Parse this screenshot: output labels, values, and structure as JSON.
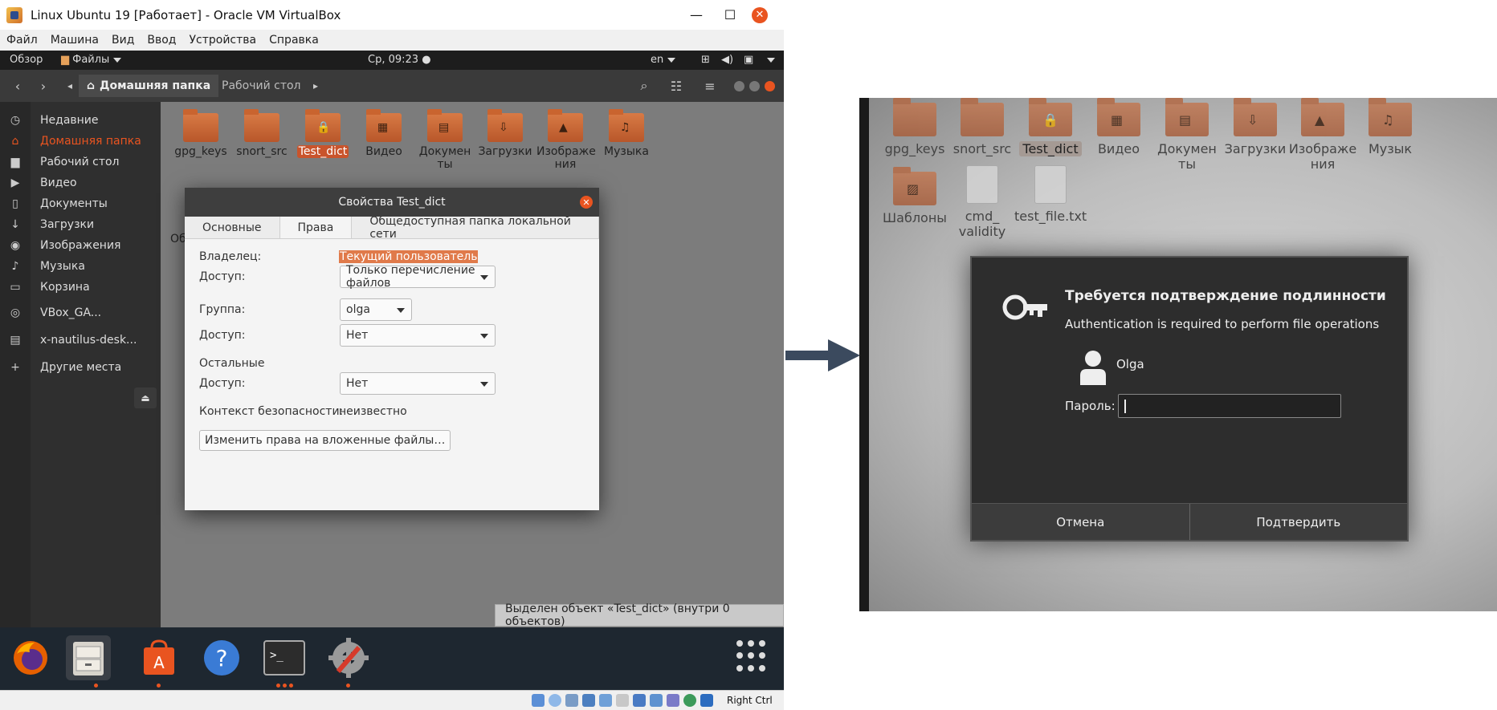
{
  "vbox": {
    "title": "Linux Ubuntu 19 [Работает] - Oracle VM VirtualBox",
    "menu": [
      "Файл",
      "Машина",
      "Вид",
      "Ввод",
      "Устройства",
      "Справка"
    ],
    "host_key": "Right Ctrl"
  },
  "gnome_topbar": {
    "overview": "Обзор",
    "app_menu": "Файлы",
    "clock": "Ср, 09:23 ●",
    "lang": "en"
  },
  "nautilus": {
    "breadcrumb_home": "Домашняя папка",
    "breadcrumb_desktop": "Рабочий стол",
    "sidebar": [
      {
        "label": "Недавние",
        "icon": "clock-icon",
        "glyph": "◷"
      },
      {
        "label": "Домашняя папка",
        "icon": "home-icon",
        "glyph": "⌂"
      },
      {
        "label": "Рабочий стол",
        "icon": "desktop-folder-icon",
        "glyph": "▆"
      },
      {
        "label": "Видео",
        "icon": "video-icon",
        "glyph": "▶"
      },
      {
        "label": "Документы",
        "icon": "document-icon",
        "glyph": "▯"
      },
      {
        "label": "Загрузки",
        "icon": "download-icon",
        "glyph": "↓"
      },
      {
        "label": "Изображения",
        "icon": "camera-icon",
        "glyph": "◉"
      },
      {
        "label": "Музыка",
        "icon": "music-icon",
        "glyph": "♪"
      },
      {
        "label": "Корзина",
        "icon": "trash-icon",
        "glyph": "▭"
      },
      {
        "label": "VBox_GA...",
        "icon": "disc-icon",
        "glyph": "◎"
      },
      {
        "label": "x-nautilus-desk...",
        "icon": "drive-icon",
        "glyph": "▤"
      },
      {
        "label": "Другие места",
        "icon": "plus-icon",
        "glyph": "+"
      }
    ],
    "files": [
      {
        "name": "gpg_keys",
        "mark": ""
      },
      {
        "name": "snort_src",
        "mark": ""
      },
      {
        "name": "Test_dict",
        "mark": "🔒"
      },
      {
        "name": "Видео",
        "mark": "▦"
      },
      {
        "name": "Докумен ты",
        "mark": "▤"
      },
      {
        "name": "Загрузки",
        "mark": "⇩"
      },
      {
        "name": "Изображе ния",
        "mark": "▲"
      },
      {
        "name": "Музыка",
        "mark": "♫"
      }
    ],
    "partial_label": "Об",
    "status": "Выделен объект «Test_dict» (внутри 0 объектов)"
  },
  "properties": {
    "title": "Свойства Test_dict",
    "tabs": [
      "Основные",
      "Права",
      "Общедоступная папка локальной сети"
    ],
    "owner_label": "Владелец:",
    "owner_value": "Текущий пользователь",
    "access_label": "Доступ:",
    "owner_access": "Только перечисление файлов",
    "group_label": "Группа:",
    "group_value": "olga",
    "group_access": "Нет",
    "others_label": "Остальные",
    "others_access": "Нет",
    "security_label": "Контекст безопасности:",
    "security_value": "неизвестно",
    "change_button": "Изменить права на вложенные файлы…"
  },
  "zoom": {
    "files": [
      {
        "name": "gpg_keys",
        "mark": ""
      },
      {
        "name": "snort_src",
        "mark": ""
      },
      {
        "name": "Test_dict",
        "mark": "🔒"
      },
      {
        "name": "Видео",
        "mark": "▦"
      },
      {
        "name": "Докумен ты",
        "mark": "▤"
      },
      {
        "name": "Загрузки",
        "mark": "⇩"
      },
      {
        "name": "Изображе ния",
        "mark": "▲"
      },
      {
        "name": "Музык",
        "mark": "♫"
      },
      {
        "name": "Шаблоны",
        "mark": "▨"
      },
      {
        "name": "cmd_ validity",
        "mark": ""
      },
      {
        "name": "test_file.txt",
        "mark": ""
      }
    ]
  },
  "auth": {
    "title": "Требуется подтверждение подлинности",
    "message": "Authentication is required to perform file operations",
    "user": "Olga",
    "password_label": "Пароль:",
    "password_value": "",
    "cancel": "Отмена",
    "confirm": "Подтвердить"
  },
  "colors": {
    "accent": "#e95420",
    "arrow": "#3b4a5e"
  }
}
